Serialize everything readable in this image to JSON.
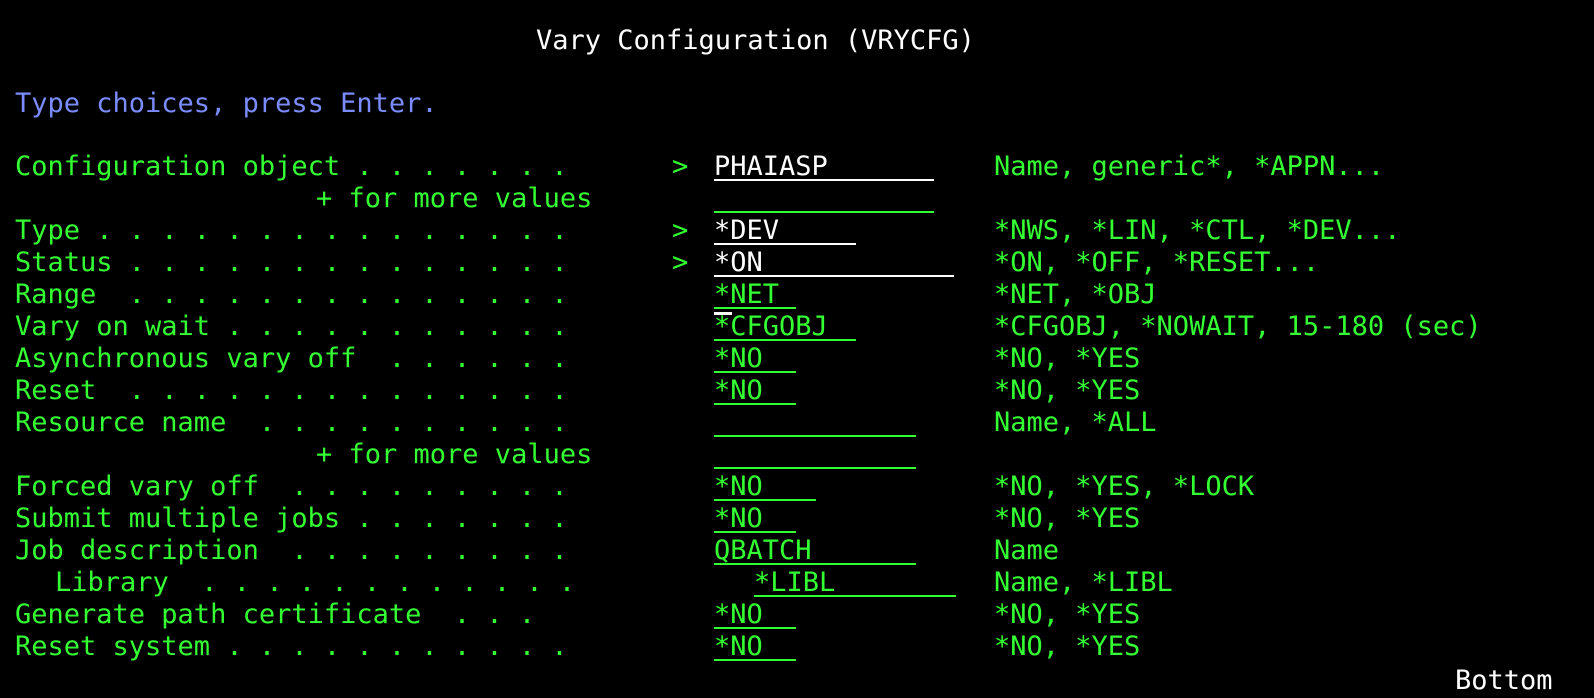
{
  "screen": {
    "title": "Vary Configuration (VRYCFG)",
    "instructions": "Type choices, press Enter.",
    "footer": "Bottom"
  },
  "rows": {
    "config_object": {
      "label": "Configuration object . . . . . . .",
      "arrow": ">",
      "value": "PHAIASP",
      "hint": "Name, generic*, *APPN..."
    },
    "config_object_more": {
      "label": "+ for more values",
      "value": ""
    },
    "type": {
      "label": "Type . . . . . . . . . . . . . . .",
      "arrow": ">",
      "value": "*DEV",
      "hint": "*NWS, *LIN, *CTL, *DEV..."
    },
    "status": {
      "label": "Status . . . . . . . . . . . . . .",
      "arrow": ">",
      "value": "*ON",
      "hint": "*ON, *OFF, *RESET..."
    },
    "range": {
      "label": "Range  . . . . . . . . . . . . . .",
      "value": "*NET",
      "hint": "*NET, *OBJ"
    },
    "vary_on_wait": {
      "label": "Vary on wait . . . . . . . . . . .",
      "value": "*CFGOBJ",
      "hint": "*CFGOBJ, *NOWAIT, 15-180 (sec)"
    },
    "async_vary_off": {
      "label": "Asynchronous vary off  . . . . . .",
      "value": "*NO",
      "hint": "*NO, *YES"
    },
    "reset": {
      "label": "Reset  . . . . . . . . . . . . . .",
      "value": "*NO",
      "hint": "*NO, *YES"
    },
    "resource_name": {
      "label": "Resource name  . . . . . . . . . .",
      "value": "",
      "hint": "Name, *ALL"
    },
    "resource_name_more": {
      "label": "+ for more values",
      "value": ""
    },
    "forced_vary_off": {
      "label": "Forced vary off  . . . . . . . . .",
      "value": "*NO",
      "hint": "*NO, *YES, *LOCK"
    },
    "submit_multiple_jobs": {
      "label": "Submit multiple jobs . . . . . . .",
      "value": "*NO",
      "hint": "*NO, *YES"
    },
    "job_description": {
      "label": "Job description  . . . . . . . . .",
      "value": "QBATCH",
      "hint": "Name"
    },
    "library": {
      "label": "Library  . . . . . . . . . . . .",
      "value": "*LIBL",
      "hint": "Name, *LIBL"
    },
    "generate_path_cert": {
      "label": "Generate path certificate  . . .",
      "value": "*NO",
      "hint": "*NO, *YES"
    },
    "reset_system": {
      "label": "Reset system . . . . . . . . . . .",
      "value": "*NO",
      "hint": "*NO, *YES"
    }
  },
  "colors": {
    "background": "#000000",
    "text_green": "#33ff33",
    "text_white": "#ffffff",
    "text_blue": "#7b8cff"
  }
}
